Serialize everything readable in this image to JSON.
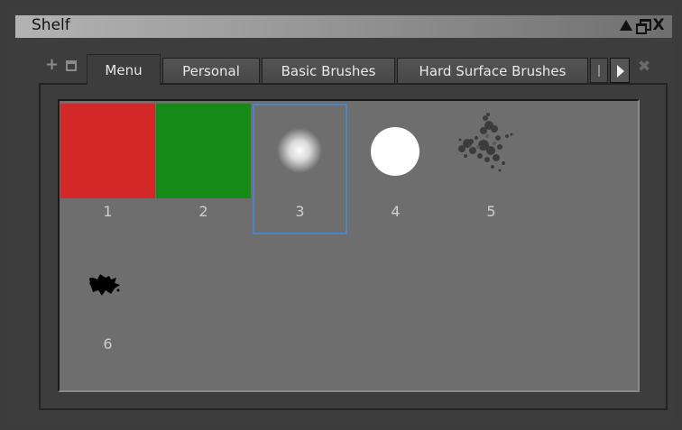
{
  "window": {
    "title": "Shelf",
    "controls": {
      "up": "triangle-up-icon",
      "restore": "restore-icon",
      "close": "X"
    }
  },
  "toolbar_icons": {
    "add": "+",
    "dock": "dock-icon"
  },
  "tabs": [
    {
      "label": "Menu",
      "active": true
    },
    {
      "label": "Personal",
      "active": false
    },
    {
      "label": "Basic Brushes",
      "active": false
    },
    {
      "label": "Hard Surface Brushes",
      "active": false
    }
  ],
  "tab_close": "✖",
  "items": [
    {
      "label": "1",
      "kind": "solid",
      "color": "#d42828"
    },
    {
      "label": "2",
      "kind": "solid",
      "color": "#168a16"
    },
    {
      "label": "3",
      "kind": "soft-brush",
      "selected": true
    },
    {
      "label": "4",
      "kind": "hard-round-brush"
    },
    {
      "label": "5",
      "kind": "splatter-brush"
    },
    {
      "label": "6",
      "kind": "ink-blot-brush"
    }
  ],
  "colors": {
    "selection": "#4a86c8",
    "shelf_bg": "#6e6e6e"
  }
}
